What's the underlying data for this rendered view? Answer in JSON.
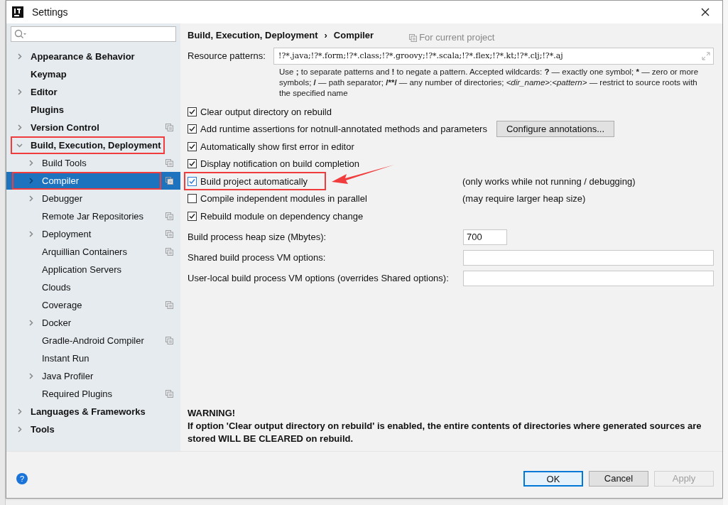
{
  "window": {
    "title": "Settings"
  },
  "sidebar": {
    "items": [
      {
        "label": "Appearance & Behavior",
        "expandable": true,
        "expanded": false,
        "selected": false,
        "highlighted": false,
        "project": false
      },
      {
        "label": "Keymap",
        "expandable": false,
        "expanded": false,
        "selected": false,
        "highlighted": false,
        "project": false
      },
      {
        "label": "Editor",
        "expandable": true,
        "expanded": false,
        "selected": false,
        "highlighted": false,
        "project": false
      },
      {
        "label": "Plugins",
        "expandable": false,
        "expanded": false,
        "selected": false,
        "highlighted": false,
        "project": false
      },
      {
        "label": "Version Control",
        "expandable": true,
        "expanded": false,
        "selected": false,
        "highlighted": false,
        "project": true
      },
      {
        "label": "Build, Execution, Deployment",
        "expandable": true,
        "expanded": true,
        "selected": false,
        "highlighted": true,
        "project": false,
        "children": [
          {
            "label": "Build Tools",
            "expandable": true,
            "expanded": false,
            "selected": false,
            "highlighted": false,
            "project": true
          },
          {
            "label": "Compiler",
            "expandable": true,
            "expanded": false,
            "selected": true,
            "highlighted": true,
            "project": true
          },
          {
            "label": "Debugger",
            "expandable": true,
            "expanded": false,
            "selected": false,
            "highlighted": false,
            "project": false
          },
          {
            "label": "Remote Jar Repositories",
            "expandable": false,
            "expanded": false,
            "selected": false,
            "highlighted": false,
            "project": true
          },
          {
            "label": "Deployment",
            "expandable": true,
            "expanded": false,
            "selected": false,
            "highlighted": false,
            "project": true
          },
          {
            "label": "Arquillian Containers",
            "expandable": false,
            "expanded": false,
            "selected": false,
            "highlighted": false,
            "project": true
          },
          {
            "label": "Application Servers",
            "expandable": false,
            "expanded": false,
            "selected": false,
            "highlighted": false,
            "project": false
          },
          {
            "label": "Clouds",
            "expandable": false,
            "expanded": false,
            "selected": false,
            "highlighted": false,
            "project": false
          },
          {
            "label": "Coverage",
            "expandable": false,
            "expanded": false,
            "selected": false,
            "highlighted": false,
            "project": true
          },
          {
            "label": "Docker",
            "expandable": true,
            "expanded": false,
            "selected": false,
            "highlighted": false,
            "project": false
          },
          {
            "label": "Gradle-Android Compiler",
            "expandable": false,
            "expanded": false,
            "selected": false,
            "highlighted": false,
            "project": true
          },
          {
            "label": "Instant Run",
            "expandable": false,
            "expanded": false,
            "selected": false,
            "highlighted": false,
            "project": false
          },
          {
            "label": "Java Profiler",
            "expandable": true,
            "expanded": false,
            "selected": false,
            "highlighted": false,
            "project": false
          },
          {
            "label": "Required Plugins",
            "expandable": false,
            "expanded": false,
            "selected": false,
            "highlighted": false,
            "project": true
          }
        ]
      },
      {
        "label": "Languages & Frameworks",
        "expandable": true,
        "expanded": false,
        "selected": false,
        "highlighted": false,
        "project": false
      },
      {
        "label": "Tools",
        "expandable": true,
        "expanded": false,
        "selected": false,
        "highlighted": false,
        "project": false
      }
    ]
  },
  "breadcrumb": {
    "items": [
      "Build, Execution, Deployment",
      "Compiler"
    ],
    "separator": "›",
    "scope": "For current project"
  },
  "resource_patterns": {
    "label": "Resource patterns:",
    "value": "!?*.java;!?*.form;!?*.class;!?*.groovy;!?*.scala;!?*.flex;!?*.kt;!?*.clj;!?*.aj",
    "hint": [
      {
        "text": "Use ",
        "kind": "plain"
      },
      {
        "text": ";",
        "kind": "bold"
      },
      {
        "text": " to separate patterns and ",
        "kind": "plain"
      },
      {
        "text": "!",
        "kind": "bold"
      },
      {
        "text": " to negate a pattern. Accepted wildcards: ",
        "kind": "plain"
      },
      {
        "text": "?",
        "kind": "bold"
      },
      {
        "text": " — exactly one symbol; ",
        "kind": "plain"
      },
      {
        "text": "*",
        "kind": "bold"
      },
      {
        "text": " — zero or more symbols; ",
        "kind": "plain"
      },
      {
        "text": "/",
        "kind": "bold"
      },
      {
        "text": " — path separator; ",
        "kind": "plain"
      },
      {
        "text": "/**/",
        "kind": "bold"
      },
      {
        "text": " — any number of directories;  ",
        "kind": "plain"
      },
      {
        "text": "<dir_name>",
        "kind": "italic"
      },
      {
        "text": ":",
        "kind": "plain"
      },
      {
        "text": "<pattern>",
        "kind": "italic"
      },
      {
        "text": " — restrict to source roots with the specified name",
        "kind": "plain"
      }
    ]
  },
  "options": [
    {
      "label": "Clear output directory on rebuild",
      "checked": true,
      "highlighted": false
    },
    {
      "label": "Add runtime assertions for notnull-annotated methods and parameters",
      "checked": true,
      "highlighted": false,
      "button": "Configure annotations..."
    },
    {
      "label": "Automatically show first error in editor",
      "checked": true,
      "highlighted": false
    },
    {
      "label": "Display notification on build completion",
      "checked": true,
      "highlighted": false
    },
    {
      "label": "Build project automatically",
      "checked": true,
      "highlighted": true,
      "note": "(only works while not running / debugging)"
    },
    {
      "label": "Compile independent modules in parallel",
      "checked": false,
      "highlighted": false,
      "note": "(may require larger heap size)"
    },
    {
      "label": "Rebuild module on dependency change",
      "checked": true,
      "highlighted": false
    }
  ],
  "fields": [
    {
      "label": "Build process heap size (Mbytes):",
      "value": "700",
      "kind": "short"
    },
    {
      "label": "Shared build process VM options:",
      "kind": "wide"
    },
    {
      "label": "User-local build process VM options (overrides Shared options):",
      "kind": "wide"
    }
  ],
  "warning": {
    "title": "WARNING!",
    "text": "If option 'Clear output directory on rebuild' is enabled, the entire contents of directories where generated sources are stored WILL BE CLEARED on rebuild."
  },
  "footer": {
    "help": "?",
    "buttons": [
      {
        "label": "OK",
        "default": true,
        "disabled": false
      },
      {
        "label": "Cancel",
        "default": false,
        "disabled": false
      },
      {
        "label": "Apply",
        "default": false,
        "disabled": true
      }
    ]
  }
}
